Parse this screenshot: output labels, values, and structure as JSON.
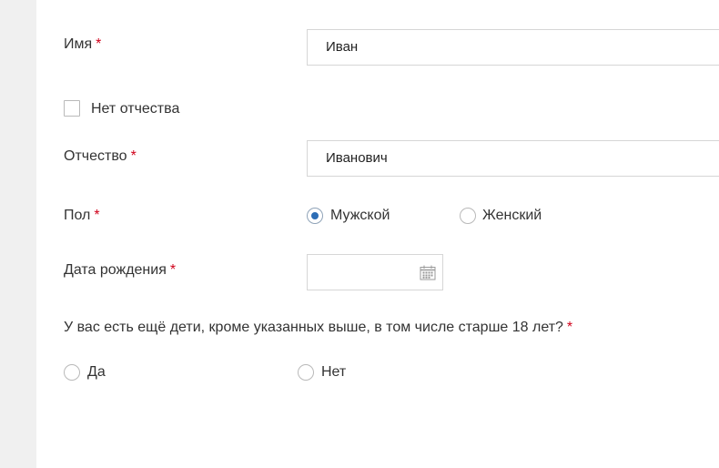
{
  "form": {
    "first_name": {
      "label": "Имя",
      "required_mark": "*",
      "value": "Иван"
    },
    "no_patronymic": {
      "label": "Нет отчества",
      "checked": false
    },
    "patronymic": {
      "label": "Отчество",
      "required_mark": "*",
      "value": "Иванович"
    },
    "gender": {
      "label": "Пол",
      "required_mark": "*",
      "options": [
        {
          "label": "Мужской",
          "selected": true
        },
        {
          "label": "Женский",
          "selected": false
        }
      ]
    },
    "birth_date": {
      "label": "Дата рождения",
      "required_mark": "*",
      "value": "",
      "icon": "calendar-icon"
    },
    "other_children": {
      "question": "У вас есть ещё дети, кроме указанных выше, в том числе старше 18 лет?",
      "required_mark": "*",
      "options": [
        {
          "label": "Да",
          "selected": false
        },
        {
          "label": "Нет",
          "selected": false
        }
      ]
    }
  },
  "colors": {
    "required": "#d0021b",
    "radio_selected": "#2d6db5",
    "border": "#d6d6d6",
    "side_strip": "#f0f0f0"
  }
}
